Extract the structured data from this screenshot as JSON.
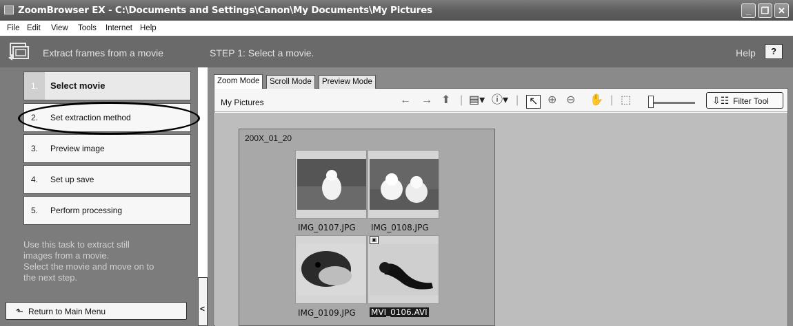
{
  "window": {
    "title": "ZoomBrowser EX  -  C:\\Documents and Settings\\Canon\\My Documents\\My Pictures",
    "buttons": {
      "minimize": "_",
      "restore": "❐",
      "close": "✕"
    }
  },
  "menu": [
    "File",
    "Edit",
    "View",
    "Tools",
    "Internet",
    "Help"
  ],
  "task": {
    "title": "Extract frames from a movie"
  },
  "steps": [
    {
      "num": "1.",
      "label": "Select movie"
    },
    {
      "num": "2.",
      "label": "Set extraction method"
    },
    {
      "num": "3.",
      "label": "Preview image"
    },
    {
      "num": "4.",
      "label": "Set up save"
    },
    {
      "num": "5.",
      "label": "Perform processing"
    }
  ],
  "description": [
    "Use this task to extract still",
    "images from a movie.",
    "Select the movie and move on to",
    "the next step."
  ],
  "return_button": "Return to Main Menu",
  "splitter_glyph": "<",
  "header": {
    "step_title": "STEP 1: Select a movie.",
    "help": "Help",
    "help_button": "?"
  },
  "tabs": [
    "Zoom Mode",
    "Scroll Mode",
    "Preview Mode"
  ],
  "breadcrumb": "My Pictures",
  "filter_button": "Filter Tool",
  "folder": {
    "name": "200X_01_20"
  },
  "thumbnails": [
    {
      "caption": "IMG_0107.JPG"
    },
    {
      "caption": "IMG_0108.JPG"
    },
    {
      "caption": "IMG_0109.JPG"
    },
    {
      "caption": "MVI_0106.AVI",
      "selected": true
    }
  ],
  "colors": {
    "panel_dark": "#6a6a6a",
    "panel_mid": "#7c7c7c",
    "selection": "#1a1a1a"
  }
}
